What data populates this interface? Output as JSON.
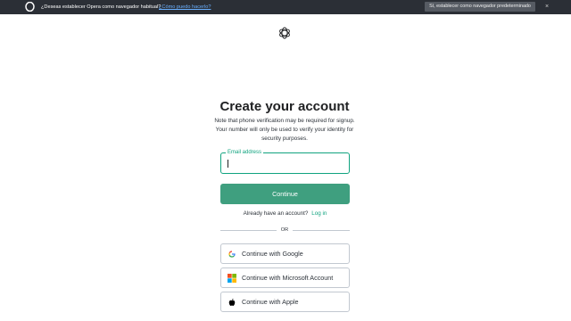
{
  "banner": {
    "question": "¿Deseas establecer Opera como navegador habitual?",
    "howto_link": "¿Cómo puedo hacerlo?",
    "set_default_button": "Sí, establecer como navegador predeterminado",
    "close_glyph": "×"
  },
  "signup": {
    "title": "Create your account",
    "subtitle": "Note that phone verification may be required for signup. Your number will only be used to verify your identity for security purposes.",
    "email_label": "Email address",
    "email_value": "",
    "continue_button": "Continue",
    "have_account_text": "Already have an account?",
    "login_link": "Log in",
    "or_text": "OR",
    "google_button": "Continue with Google",
    "microsoft_button": "Continue with Microsoft Account",
    "apple_button": "Continue with Apple"
  },
  "icons": {
    "browser_logo": "opera-icon",
    "brand_logo": "openai-logo-icon",
    "google": "google-icon",
    "microsoft": "microsoft-icon",
    "apple": "apple-icon"
  },
  "colors": {
    "accent": "#10a37f",
    "continue_button": "#3f9f7f",
    "banner_background": "#2b2f36",
    "border": "#c2c8d0"
  }
}
